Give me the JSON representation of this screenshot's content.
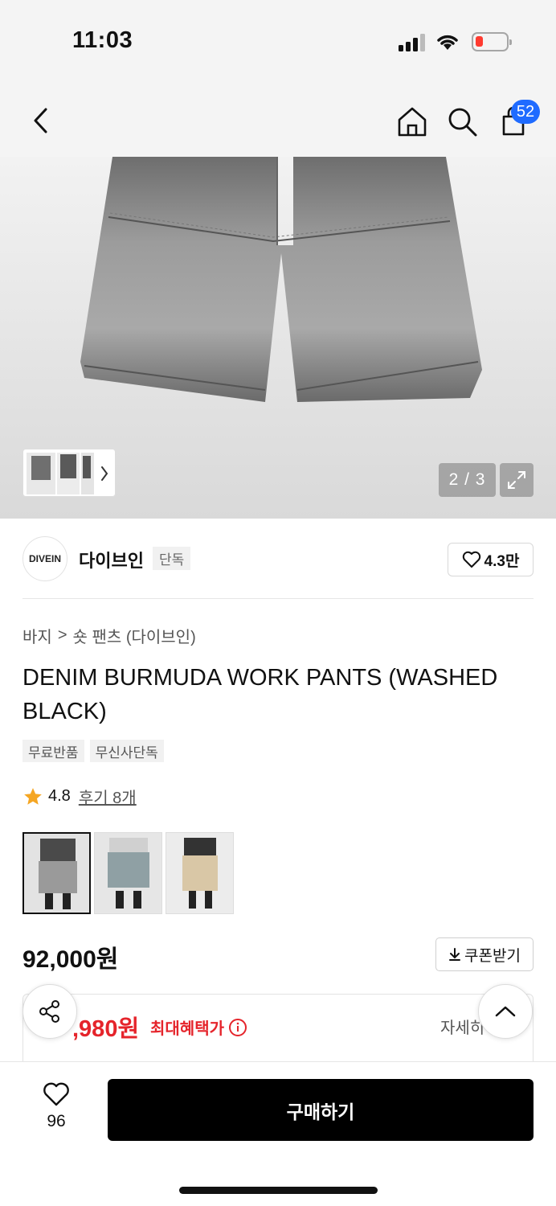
{
  "status_bar": {
    "time": "11:03"
  },
  "header": {
    "cart_count": "52"
  },
  "gallery": {
    "pager": "2 / 3"
  },
  "brand": {
    "logo_text": "DIVEIN",
    "name": "다이브인",
    "tag": "단독",
    "likes": "4.3만"
  },
  "breadcrumb": {
    "category": "바지",
    "separator": ">",
    "subcategory": "숏 팬츠 (다이브인)"
  },
  "product": {
    "title": "DENIM BURMUDA WORK PANTS (WASHED BLACK)",
    "tags": [
      "무료반품",
      "무신사단독"
    ],
    "rating": "4.8",
    "reviews_label": "후기 8개",
    "price": "92,000원",
    "coupon_label": "쿠폰받기"
  },
  "benefit": {
    "price": ",980원",
    "label": "최대혜택가",
    "more": "자세히"
  },
  "bottom_bar": {
    "wish_count": "96",
    "buy_label": "구매하기"
  },
  "colors": {
    "accent_red": "#e5242b",
    "badge_blue": "#1f6bff",
    "star": "#f5a623"
  }
}
